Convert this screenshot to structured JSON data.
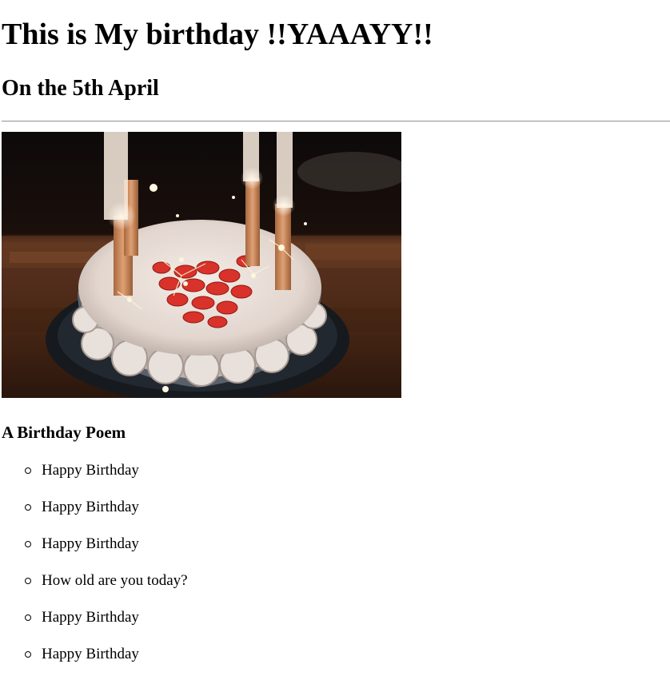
{
  "header": {
    "title": "This is My birthday !!YAAAYY!!",
    "subtitle": "On the 5th April"
  },
  "photo": {
    "subject": "birthday cake with strawberries, candles and sparklers"
  },
  "poem": {
    "heading": "A Birthday Poem",
    "lines": [
      "Happy Birthday",
      "Happy Birthday",
      "Happy Birthday",
      "How old are you today?",
      "Happy Birthday",
      "Happy Birthday"
    ]
  }
}
